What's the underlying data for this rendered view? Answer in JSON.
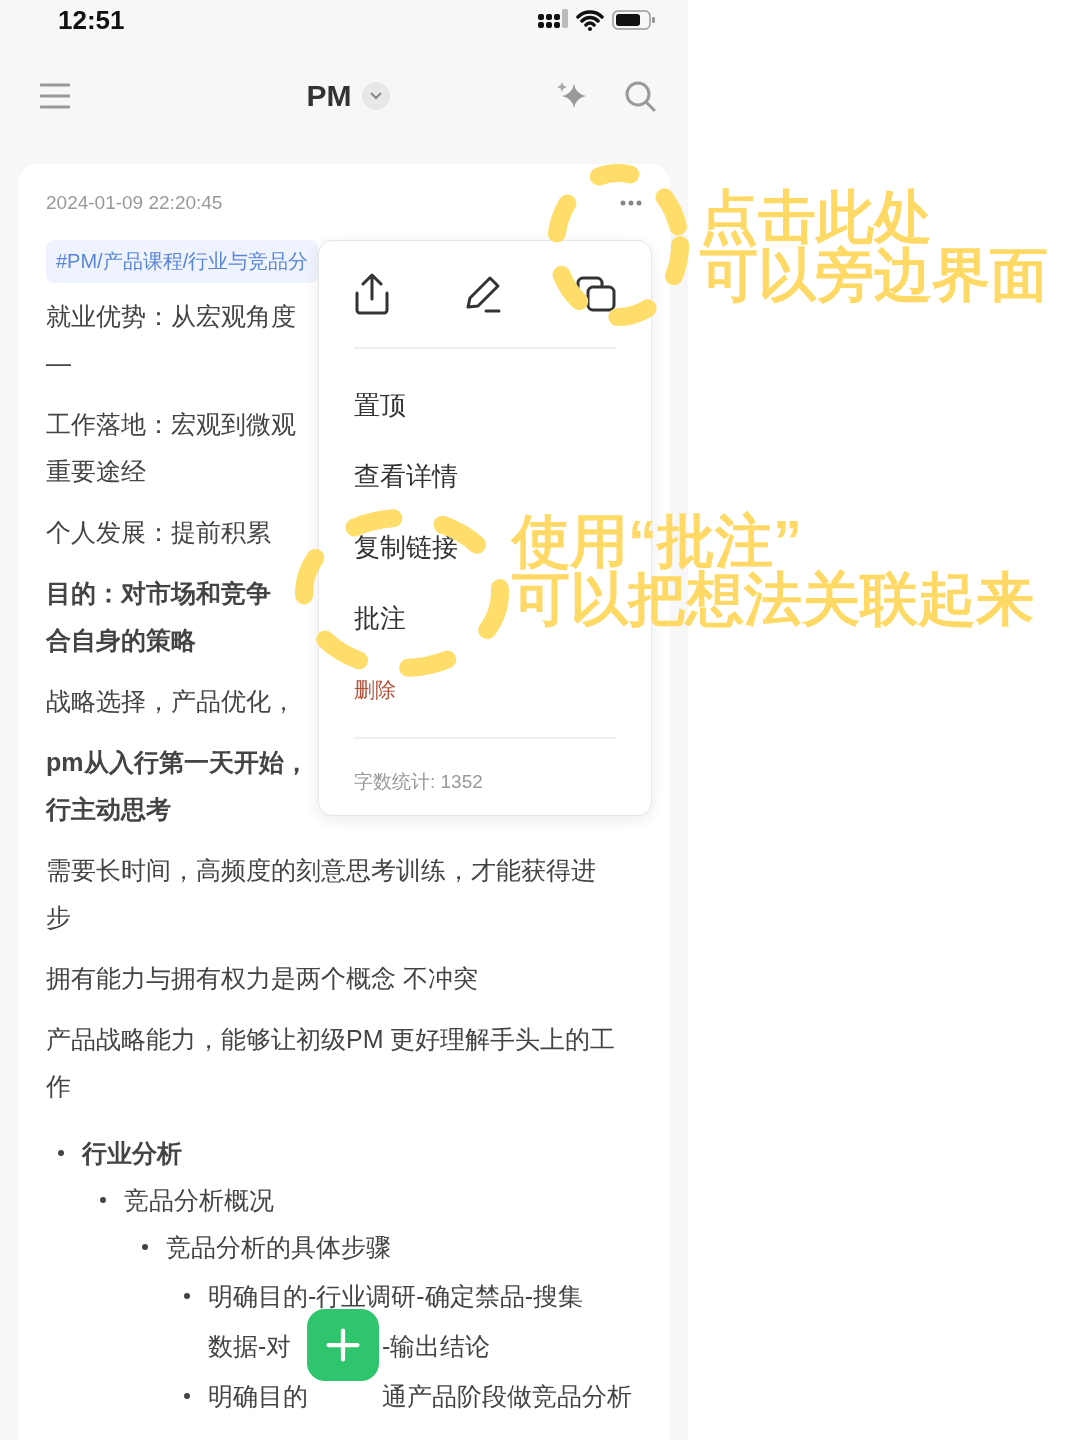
{
  "status_bar": {
    "time": "12:51"
  },
  "nav": {
    "title": "PM"
  },
  "note": {
    "timestamp": "2024-01-09 22:20:45",
    "tag": "#PM/产品课程/行业与竞品分",
    "blocks": [
      {
        "bold": false,
        "lines": [
          "就业优势：从宏观角度",
          "—"
        ]
      },
      {
        "bold": false,
        "lines": [
          "工作落地：宏观到微观",
          "重要途经"
        ]
      },
      {
        "bold": false,
        "lines": [
          "个人发展：提前积累"
        ]
      },
      {
        "bold": true,
        "lines": [
          "目的：对市场和竞争",
          "合自身的策略"
        ]
      },
      {
        "bold": false,
        "lines": [
          "战略选择，产品优化，"
        ]
      },
      {
        "bold": true,
        "lines": [
          "pm从入行第一天开始，",
          "行主动思考"
        ]
      },
      {
        "bold": false,
        "lines": [
          "需要长时间，高频度的刻意思考训练，才能获得进",
          "步"
        ]
      },
      {
        "bold": false,
        "lines": [
          "拥有能力与拥有权力是两个概念 不冲突"
        ]
      },
      {
        "bold": false,
        "lines": [
          "产品战略能力，能够让初级PM 更好理解手头上的工",
          "作"
        ]
      }
    ],
    "outline": [
      {
        "text": "行业分析",
        "bold": true,
        "children": [
          {
            "text": "竞品分析概况",
            "bold": false,
            "children": [
              {
                "text": "竞品分析的具体步骤",
                "bold": false,
                "children": [
                  {
                    "lines": [
                      [
                        "明确目的-行业调研-确定禁品-搜集"
                      ],
                      [
                        "数据-对",
                        "-输出结论"
                      ]
                    ],
                    "bold": false
                  },
                  {
                    "lines": [
                      [
                        "明确目的",
                        "通产品阶段做竞品分析"
                      ]
                    ],
                    "bold": false
                  }
                ]
              }
            ]
          }
        ]
      }
    ]
  },
  "menu": {
    "items": [
      {
        "label": "置顶",
        "kind": "normal"
      },
      {
        "label": "查看详情",
        "kind": "normal"
      },
      {
        "label": "复制链接",
        "kind": "normal"
      },
      {
        "label": "批注",
        "kind": "normal"
      },
      {
        "label": "删除",
        "kind": "danger"
      }
    ],
    "word_count": "字数统计: 1352"
  },
  "annotations": [
    {
      "lines": [
        "点击此处",
        "可以旁边界面"
      ]
    },
    {
      "lines": [
        "使用“批注”",
        "可以把想法关联起来"
      ]
    }
  ]
}
